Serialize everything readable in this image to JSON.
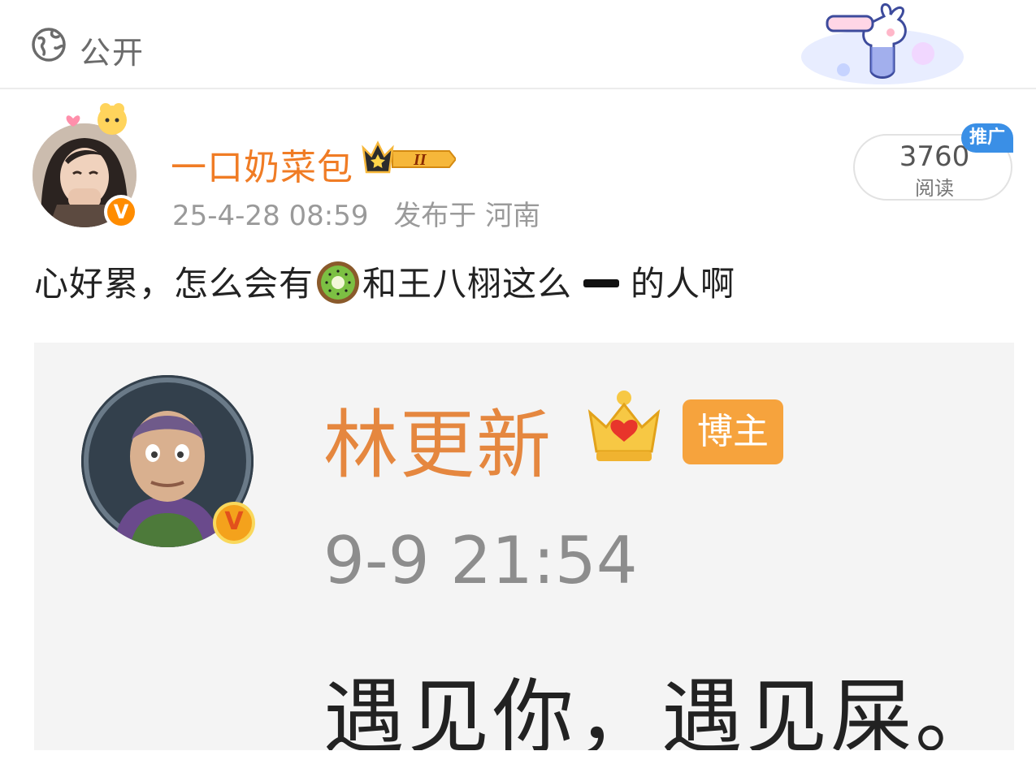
{
  "topbar": {
    "visibility_icon": "globe-icon",
    "visibility_label": "公开",
    "sticker": "bunny-telescope-sticker"
  },
  "post": {
    "author": {
      "name": "一口奶菜包",
      "avatar": "user-avatar",
      "verified_mark": "V",
      "level_badge": "crown-level-badge",
      "level_text": "II"
    },
    "time": "25-4-28 08:59",
    "location": "发布于 河南",
    "reads": {
      "count": "3760",
      "label": "阅读",
      "promo_tag": "推广"
    },
    "text": {
      "part1": "心好累，怎么会有",
      "emoji": "kiwi-emoji",
      "part2": "和王八栩这么",
      "dash": "dash-symbol",
      "part3": "的人啊"
    }
  },
  "embedded_image": {
    "name": "林更新",
    "verified_mark": "V",
    "crown": "crown-icon",
    "tag": "博主",
    "time": "9-9 21:54",
    "quote": "遇见你，遇见屎。"
  },
  "colors": {
    "orange_name": "#f07c25",
    "meta_gray": "#9a9a9a",
    "promo_blue": "#3a8fe6"
  }
}
